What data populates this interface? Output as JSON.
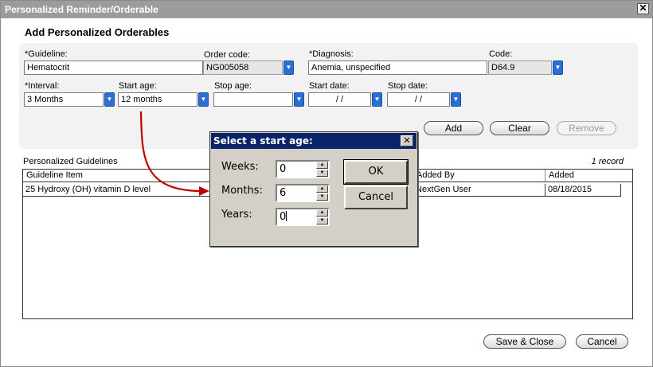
{
  "window": {
    "title": "Personalized Reminder/Orderable",
    "close": "✕"
  },
  "heading": "Add Personalized Orderables",
  "form": {
    "guideline_label": "*Guideline:",
    "guideline_value": "Hematocrit",
    "order_code_label": "Order code:",
    "order_code_value": "NG005058",
    "diagnosis_label": "*Diagnosis:",
    "diagnosis_value": "Anemia, unspecified",
    "code_label": "Code:",
    "code_value": "D64.9",
    "interval_label": "*Interval:",
    "interval_value": "3 Months",
    "start_age_label": "Start age:",
    "start_age_value": "12 months",
    "stop_age_label": "Stop age:",
    "stop_age_value": "",
    "start_date_label": "Start date:",
    "start_date_value": "/ /",
    "stop_date_label": "Stop date:",
    "stop_date_value": "/ /",
    "add_label": "Add",
    "clear_label": "Clear",
    "remove_label": "Remove"
  },
  "grid": {
    "title": "Personalized Guidelines",
    "record_count": "1 record",
    "columns": [
      "Guideline Item",
      "Added By",
      "Added"
    ],
    "rows": [
      {
        "item": "25 Hydroxy (OH) vitamin D level",
        "added_by": "NextGen User",
        "added": "08/18/2015"
      }
    ]
  },
  "footer": {
    "save_close_label": "Save & Close",
    "cancel_label": "Cancel"
  },
  "dialog": {
    "title": "Select a start age:",
    "close": "✕",
    "weeks_label": "Weeks:",
    "weeks_value": "0",
    "months_label": "Months:",
    "months_value": "6",
    "years_label": "Years:",
    "years_value": "0",
    "ok_label": "OK",
    "cancel_label": "Cancel"
  },
  "colors": {
    "arrow": "#c00000",
    "dialog_titlebar": "#0a246a",
    "dropdown_button": "#2b6fd6"
  }
}
